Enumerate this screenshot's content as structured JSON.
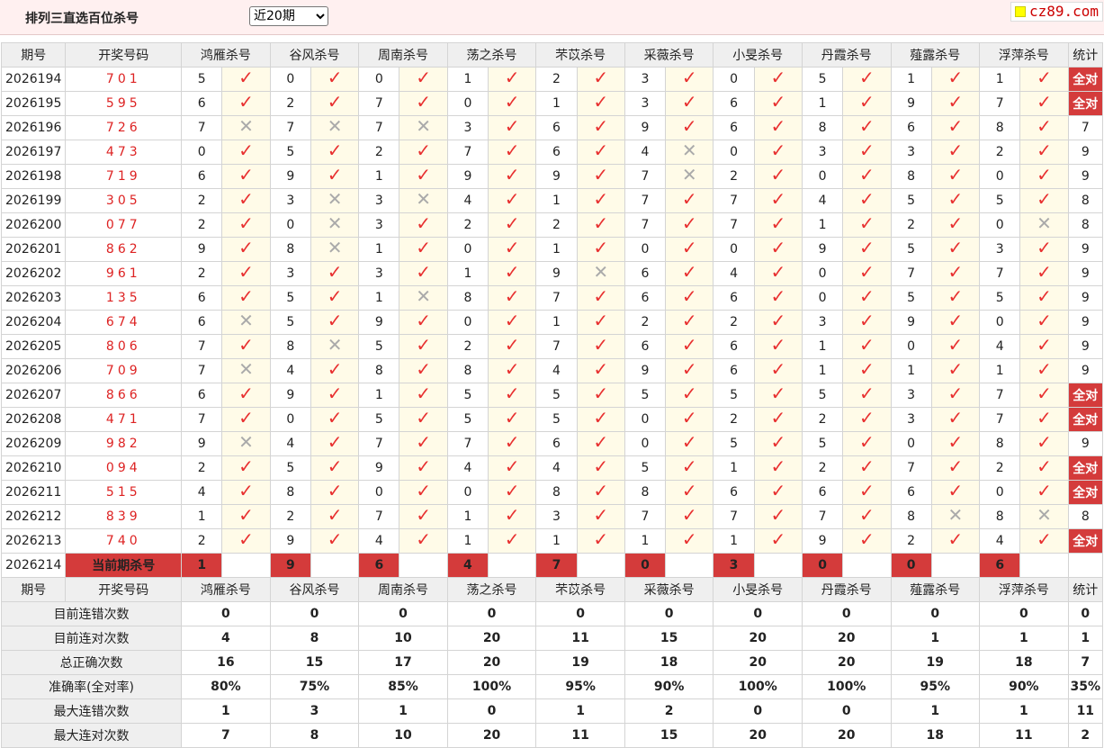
{
  "header": {
    "title": "排列三直选百位杀号",
    "period_select": "近20期",
    "logo_text": "cz89.com"
  },
  "columns": {
    "issue": "期号",
    "winning": "开奖号码",
    "experts": [
      "鸿雁杀号",
      "谷风杀号",
      "周南杀号",
      "荡之杀号",
      "芣苡杀号",
      "采薇杀号",
      "小旻杀号",
      "丹霞杀号",
      "薤露杀号",
      "浮萍杀号"
    ],
    "stat": "统计"
  },
  "rows": [
    {
      "issue": "2026194",
      "num": "701",
      "picks": [
        [
          5,
          1
        ],
        [
          0,
          1
        ],
        [
          0,
          1
        ],
        [
          1,
          1
        ],
        [
          2,
          1
        ],
        [
          3,
          1
        ],
        [
          0,
          1
        ],
        [
          5,
          1
        ],
        [
          1,
          1
        ],
        [
          1,
          1
        ]
      ],
      "stat": "全对"
    },
    {
      "issue": "2026195",
      "num": "595",
      "picks": [
        [
          6,
          1
        ],
        [
          2,
          1
        ],
        [
          7,
          1
        ],
        [
          0,
          1
        ],
        [
          1,
          1
        ],
        [
          3,
          1
        ],
        [
          6,
          1
        ],
        [
          1,
          1
        ],
        [
          9,
          1
        ],
        [
          7,
          1
        ]
      ],
      "stat": "全对"
    },
    {
      "issue": "2026196",
      "num": "726",
      "picks": [
        [
          7,
          0
        ],
        [
          7,
          0
        ],
        [
          7,
          0
        ],
        [
          3,
          1
        ],
        [
          6,
          1
        ],
        [
          9,
          1
        ],
        [
          6,
          1
        ],
        [
          8,
          1
        ],
        [
          6,
          1
        ],
        [
          8,
          1
        ]
      ],
      "stat": "7"
    },
    {
      "issue": "2026197",
      "num": "473",
      "picks": [
        [
          0,
          1
        ],
        [
          5,
          1
        ],
        [
          2,
          1
        ],
        [
          7,
          1
        ],
        [
          6,
          1
        ],
        [
          4,
          0
        ],
        [
          0,
          1
        ],
        [
          3,
          1
        ],
        [
          3,
          1
        ],
        [
          2,
          1
        ]
      ],
      "stat": "9"
    },
    {
      "issue": "2026198",
      "num": "719",
      "picks": [
        [
          6,
          1
        ],
        [
          9,
          1
        ],
        [
          1,
          1
        ],
        [
          9,
          1
        ],
        [
          9,
          1
        ],
        [
          7,
          0
        ],
        [
          2,
          1
        ],
        [
          0,
          1
        ],
        [
          8,
          1
        ],
        [
          0,
          1
        ]
      ],
      "stat": "9"
    },
    {
      "issue": "2026199",
      "num": "305",
      "picks": [
        [
          2,
          1
        ],
        [
          3,
          0
        ],
        [
          3,
          0
        ],
        [
          4,
          1
        ],
        [
          1,
          1
        ],
        [
          7,
          1
        ],
        [
          7,
          1
        ],
        [
          4,
          1
        ],
        [
          5,
          1
        ],
        [
          5,
          1
        ]
      ],
      "stat": "8"
    },
    {
      "issue": "2026200",
      "num": "077",
      "picks": [
        [
          2,
          1
        ],
        [
          0,
          0
        ],
        [
          3,
          1
        ],
        [
          2,
          1
        ],
        [
          2,
          1
        ],
        [
          7,
          1
        ],
        [
          7,
          1
        ],
        [
          1,
          1
        ],
        [
          2,
          1
        ],
        [
          0,
          0
        ]
      ],
      "stat": "8"
    },
    {
      "issue": "2026201",
      "num": "862",
      "picks": [
        [
          9,
          1
        ],
        [
          8,
          0
        ],
        [
          1,
          1
        ],
        [
          0,
          1
        ],
        [
          1,
          1
        ],
        [
          0,
          1
        ],
        [
          0,
          1
        ],
        [
          9,
          1
        ],
        [
          5,
          1
        ],
        [
          3,
          1
        ]
      ],
      "stat": "9"
    },
    {
      "issue": "2026202",
      "num": "961",
      "picks": [
        [
          2,
          1
        ],
        [
          3,
          1
        ],
        [
          3,
          1
        ],
        [
          1,
          1
        ],
        [
          9,
          0
        ],
        [
          6,
          1
        ],
        [
          4,
          1
        ],
        [
          0,
          1
        ],
        [
          7,
          1
        ],
        [
          7,
          1
        ]
      ],
      "stat": "9"
    },
    {
      "issue": "2026203",
      "num": "135",
      "picks": [
        [
          6,
          1
        ],
        [
          5,
          1
        ],
        [
          1,
          0
        ],
        [
          8,
          1
        ],
        [
          7,
          1
        ],
        [
          6,
          1
        ],
        [
          6,
          1
        ],
        [
          0,
          1
        ],
        [
          5,
          1
        ],
        [
          5,
          1
        ]
      ],
      "stat": "9"
    },
    {
      "issue": "2026204",
      "num": "674",
      "picks": [
        [
          6,
          0
        ],
        [
          5,
          1
        ],
        [
          9,
          1
        ],
        [
          0,
          1
        ],
        [
          1,
          1
        ],
        [
          2,
          1
        ],
        [
          2,
          1
        ],
        [
          3,
          1
        ],
        [
          9,
          1
        ],
        [
          0,
          1
        ]
      ],
      "stat": "9"
    },
    {
      "issue": "2026205",
      "num": "806",
      "picks": [
        [
          7,
          1
        ],
        [
          8,
          0
        ],
        [
          5,
          1
        ],
        [
          2,
          1
        ],
        [
          7,
          1
        ],
        [
          6,
          1
        ],
        [
          6,
          1
        ],
        [
          1,
          1
        ],
        [
          0,
          1
        ],
        [
          4,
          1
        ]
      ],
      "stat": "9"
    },
    {
      "issue": "2026206",
      "num": "709",
      "picks": [
        [
          7,
          0
        ],
        [
          4,
          1
        ],
        [
          8,
          1
        ],
        [
          8,
          1
        ],
        [
          4,
          1
        ],
        [
          9,
          1
        ],
        [
          6,
          1
        ],
        [
          1,
          1
        ],
        [
          1,
          1
        ],
        [
          1,
          1
        ]
      ],
      "stat": "9"
    },
    {
      "issue": "2026207",
      "num": "866",
      "picks": [
        [
          6,
          1
        ],
        [
          9,
          1
        ],
        [
          1,
          1
        ],
        [
          5,
          1
        ],
        [
          5,
          1
        ],
        [
          5,
          1
        ],
        [
          5,
          1
        ],
        [
          5,
          1
        ],
        [
          3,
          1
        ],
        [
          7,
          1
        ]
      ],
      "stat": "全对"
    },
    {
      "issue": "2026208",
      "num": "471",
      "picks": [
        [
          7,
          1
        ],
        [
          0,
          1
        ],
        [
          5,
          1
        ],
        [
          5,
          1
        ],
        [
          5,
          1
        ],
        [
          0,
          1
        ],
        [
          2,
          1
        ],
        [
          2,
          1
        ],
        [
          3,
          1
        ],
        [
          7,
          1
        ]
      ],
      "stat": "全对"
    },
    {
      "issue": "2026209",
      "num": "982",
      "picks": [
        [
          9,
          0
        ],
        [
          4,
          1
        ],
        [
          7,
          1
        ],
        [
          7,
          1
        ],
        [
          6,
          1
        ],
        [
          0,
          1
        ],
        [
          5,
          1
        ],
        [
          5,
          1
        ],
        [
          0,
          1
        ],
        [
          8,
          1
        ]
      ],
      "stat": "9"
    },
    {
      "issue": "2026210",
      "num": "094",
      "picks": [
        [
          2,
          1
        ],
        [
          5,
          1
        ],
        [
          9,
          1
        ],
        [
          4,
          1
        ],
        [
          4,
          1
        ],
        [
          5,
          1
        ],
        [
          1,
          1
        ],
        [
          2,
          1
        ],
        [
          7,
          1
        ],
        [
          2,
          1
        ]
      ],
      "stat": "全对"
    },
    {
      "issue": "2026211",
      "num": "515",
      "picks": [
        [
          4,
          1
        ],
        [
          8,
          1
        ],
        [
          0,
          1
        ],
        [
          0,
          1
        ],
        [
          8,
          1
        ],
        [
          8,
          1
        ],
        [
          6,
          1
        ],
        [
          6,
          1
        ],
        [
          6,
          1
        ],
        [
          0,
          1
        ]
      ],
      "stat": "全对"
    },
    {
      "issue": "2026212",
      "num": "839",
      "picks": [
        [
          1,
          1
        ],
        [
          2,
          1
        ],
        [
          7,
          1
        ],
        [
          1,
          1
        ],
        [
          3,
          1
        ],
        [
          7,
          1
        ],
        [
          7,
          1
        ],
        [
          7,
          1
        ],
        [
          8,
          0
        ],
        [
          8,
          0
        ]
      ],
      "stat": "8"
    },
    {
      "issue": "2026213",
      "num": "740",
      "picks": [
        [
          2,
          1
        ],
        [
          9,
          1
        ],
        [
          4,
          1
        ],
        [
          1,
          1
        ],
        [
          1,
          1
        ],
        [
          1,
          1
        ],
        [
          1,
          1
        ],
        [
          9,
          1
        ],
        [
          2,
          1
        ],
        [
          4,
          1
        ]
      ],
      "stat": "全对"
    }
  ],
  "current": {
    "issue": "2026214",
    "label": "当前期杀号",
    "picks": [
      "1",
      "9",
      "6",
      "4",
      "7",
      "0",
      "3",
      "0",
      "0",
      "6"
    ]
  },
  "stats": [
    {
      "label": "目前连错次数",
      "values": [
        "0",
        "0",
        "0",
        "0",
        "0",
        "0",
        "0",
        "0",
        "0",
        "0"
      ],
      "total": "0",
      "type": "count"
    },
    {
      "label": "目前连对次数",
      "values": [
        "4",
        "8",
        "10",
        "20",
        "11",
        "15",
        "20",
        "20",
        "1",
        "1"
      ],
      "total": "1",
      "type": "count"
    },
    {
      "label": "总正确次数",
      "values": [
        "16",
        "15",
        "17",
        "20",
        "19",
        "18",
        "20",
        "20",
        "19",
        "18"
      ],
      "total": "7",
      "type": "count"
    },
    {
      "label": "准确率(全对率)",
      "values": [
        "80%",
        "75%",
        "85%",
        "100%",
        "95%",
        "90%",
        "100%",
        "100%",
        "95%",
        "90%"
      ],
      "total": "35%",
      "type": "rate"
    },
    {
      "label": "最大连错次数",
      "values": [
        "1",
        "3",
        "1",
        "0",
        "1",
        "2",
        "0",
        "0",
        "1",
        "1"
      ],
      "total": "11",
      "type": "count"
    },
    {
      "label": "最大连对次数",
      "values": [
        "7",
        "8",
        "10",
        "20",
        "11",
        "15",
        "20",
        "20",
        "18",
        "11"
      ],
      "total": "2",
      "type": "count"
    }
  ],
  "symbols": {
    "correct": "✓",
    "wrong": "✕"
  },
  "colors": {
    "accent_red": "#d43b3b",
    "stat_blue": "#1a3fcc",
    "check_red": "#e83030",
    "mark_bg": "#fffbe8",
    "header_bg": "#efefef"
  }
}
